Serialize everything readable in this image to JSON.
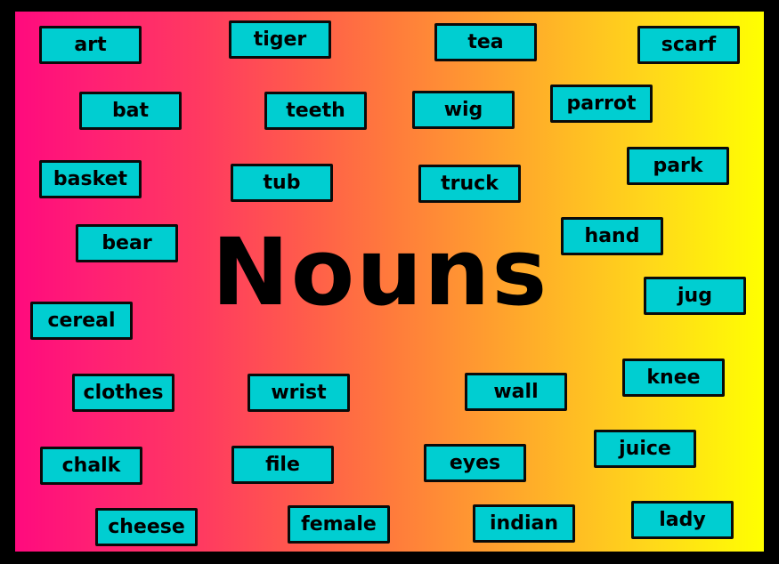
{
  "title": "Nouns",
  "colors": {
    "card_fill": "#00ced1",
    "card_border": "#0a0a0a",
    "gradient_left": "#ff0a7e",
    "gradient_right": "#ffff00",
    "frame": "#000000"
  },
  "words": [
    "art",
    "tiger",
    "tea",
    "scarf",
    "bat",
    "teeth",
    "wig",
    "parrot",
    "basket",
    "tub",
    "truck",
    "park",
    "bear",
    "hand",
    "cereal",
    "jug",
    "clothes",
    "wrist",
    "wall",
    "knee",
    "chalk",
    "file",
    "eyes",
    "juice",
    "cheese",
    "female",
    "indian",
    "lady"
  ]
}
